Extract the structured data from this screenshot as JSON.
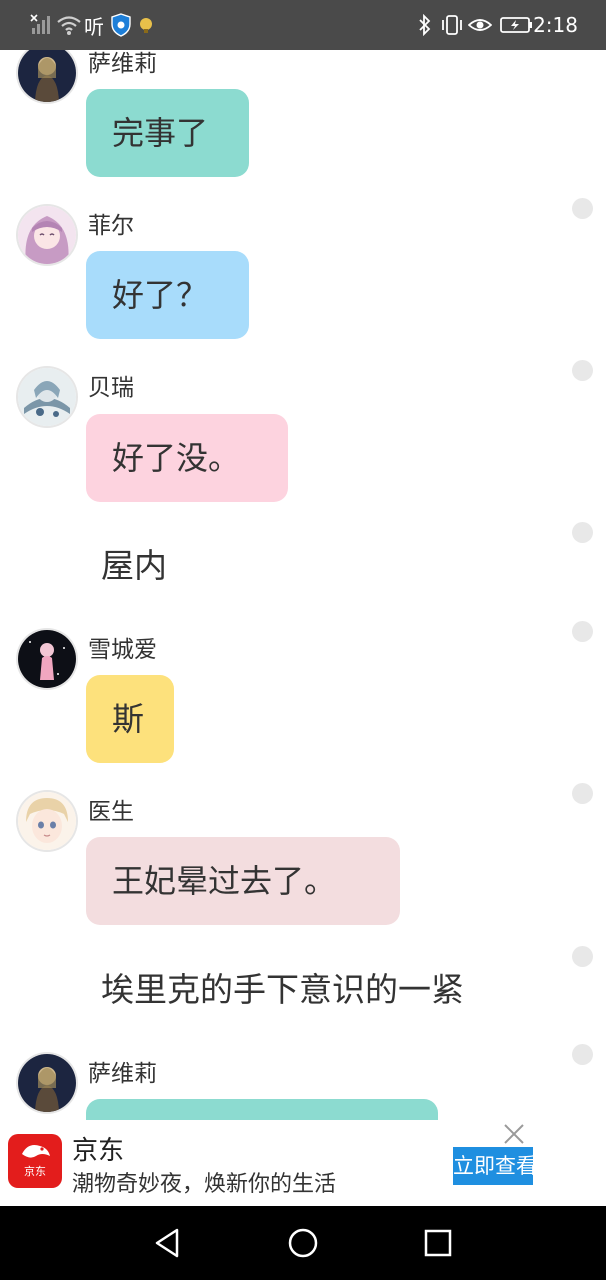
{
  "status_bar": {
    "time": "2:18",
    "listen_label": "听",
    "left_icons": [
      "no-signal-icon",
      "wifi-icon",
      "shield-app-icon",
      "notification-app-icon"
    ],
    "right_icons": [
      "bluetooth-icon",
      "vibrate-icon",
      "eye-comfort-icon",
      "battery-charging-icon"
    ]
  },
  "messages": [
    {
      "kind": "bubble",
      "speaker": "萨维莉",
      "text": "完事了",
      "color": "#8cdbd0",
      "avatar": "avatar-saveli"
    },
    {
      "kind": "bubble",
      "speaker": "菲尔",
      "text": "好了？",
      "color": "#a8dcfb",
      "avatar": "avatar-fier"
    },
    {
      "kind": "bubble",
      "speaker": "贝瑞",
      "text": "好了没。",
      "color": "#fdd3df",
      "avatar": "avatar-beirui"
    },
    {
      "kind": "narration",
      "text": "屋内"
    },
    {
      "kind": "bubble",
      "speaker": "雪城爱",
      "text": "斯",
      "color": "#fde17c",
      "avatar": "avatar-xuechengai"
    },
    {
      "kind": "bubble",
      "speaker": "医生",
      "text": "王妃晕过去了。",
      "color": "#f3dddf",
      "avatar": "avatar-yisheng"
    },
    {
      "kind": "narration",
      "text": "埃里克的手下意识的一紧"
    },
    {
      "kind": "bubble",
      "speaker": "萨维莉",
      "text": "",
      "color": "#8cdbd0",
      "avatar": "avatar-saveli"
    }
  ],
  "ad": {
    "brand": "京东",
    "logo_text": "京东",
    "description": "潮物奇妙夜，焕新你的生活",
    "cta": "立即查看",
    "brand_color": "#e31d1c",
    "cta_color": "#1f8fe0"
  },
  "nav": {
    "icons": [
      "back-icon",
      "home-icon",
      "recents-icon"
    ]
  }
}
